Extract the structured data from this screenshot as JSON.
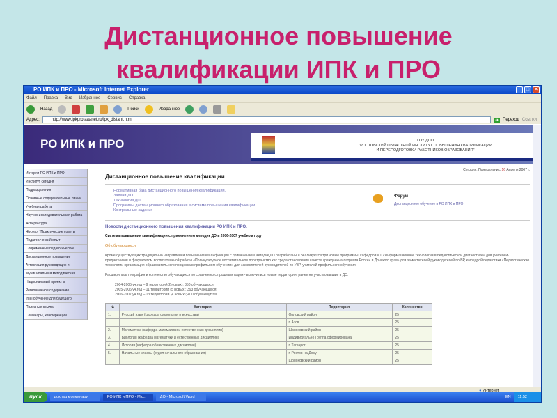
{
  "slide": {
    "title_line1": "Дистанционное повышение",
    "title_line2": "квалификации ИПК и ПРО"
  },
  "browser": {
    "title": "РО ИПК и ПРО - Microsoft Internet Explorer",
    "menu": [
      "Файл",
      "Правка",
      "Вид",
      "Избранное",
      "Сервис",
      "Справка"
    ],
    "toolbar": {
      "back": "Назад",
      "search": "Поиск",
      "favorites": "Избранное"
    },
    "address_label": "Адрес:",
    "address": "http://www.ipkpro.aaanet.ru/ipk_distant.html",
    "go": "Переход",
    "links": "Ссылки",
    "status": "Интернет"
  },
  "site": {
    "logo": "РО ИПК и ПРО",
    "org_line1": "ГОУ ДПО",
    "org_line2": "\"РОСТОВСКИЙ ОБЛАСТНОЙ ИНСТИТУТ ПОВЫШЕНИЯ КВАЛИФИКАЦИИ",
    "org_line3": "И ПЕРЕПОДГОТОВКИ РАБОТНИКОВ ОБРАЗОВАНИЯ\"",
    "date_prefix": "Сегодня: Понедельник,",
    "date_day": "16",
    "date_suffix": "Апреля 2007 г."
  },
  "sidebar": [
    "История РО ИПК и ПРО",
    "Институт сегодня",
    "Подразделения",
    "Основные содержательные линии ИПК",
    "Учебная работа",
    "Научно-исследовательская работа",
    "Аспирантура",
    "Журнал \"Практические советы учителю\"",
    "Педагогический опыт",
    "Современные педагогические технологии",
    "Дистанционное повышение квалификации",
    "Аттестация руководящих и педагогических кадров",
    "Муниципальная методическая служба",
    "Национальный проект в образовании",
    "Региональное содержание образования",
    "Intel обучение для будущего",
    "Полезные ссылки",
    "Семинары, конференции"
  ],
  "main": {
    "heading": "Дистанционное повышение квалификации",
    "links": [
      "Нормативная база дистанционного повышения квалификации.",
      "Задачи ДО",
      "Технология ДО",
      "Программы дистанционного образования в системе повышения квалификации",
      "Контрольные задания"
    ],
    "forum_title": "Форум",
    "forum_link": "Дистанционное обучение в РО ИПК и ПРО",
    "news_title": "Новости дистанционного повышения квалификации РО ИПК и ПРО.",
    "subtitle": "Система повышения квалификации с применением методик ДО в 2006-2007 учебном году",
    "section": "Об обучающихся",
    "para1": "Кроме существующих традиционно направлений повышения квалификации с применением методик ДО разработаны и реализуются три новые программы: кафедрой ИТ «Информационные технологии в педагогической диагностике» для учителей-предметников и факультетом воспитательной работы «Поликультурное воспитательное пространство как среда становления качеств гражданина-патриота России и Донского края» для заместителей руководителей по ВР, кафедрой педагогики «Педагогические технологии организации образовательного процесса в профильном обучении» для заместителей руководителей по УВР, учителей профильного обучения.",
    "para2": "Расширилась география и количество обучающихся по сравнению с прошлым годом - включились новые территории, ранее не участвовавшие в ДО.",
    "bullets": [
      "2004-2005 уч.год – 9 территорий(2 новых); 350 обучающихся;",
      "2005-2006 уч.год – 11 территорий (5 новых); 393 обучающихся;",
      "2006-2007 уч.год – 13 территорий (4 новых); 400 обучающихся."
    ],
    "table": {
      "headers": [
        "№",
        "Категория",
        "Территория",
        "Количество"
      ],
      "rows": [
        [
          "1.",
          "Русский язык (кафедра филологии и искусства)",
          "Орловский район",
          "25"
        ],
        [
          "",
          "",
          "г. Азов",
          "25"
        ],
        [
          "2.",
          "Математика (кафедра математики и естественных дисциплин)",
          "Шолоховский район",
          "25"
        ],
        [
          "3.",
          "Биология (кафедра математики и естественных дисциплин)",
          "Индивидуально Группа оформирована",
          "25"
        ],
        [
          "4.",
          "История (кафедра общественных дисциплин)",
          "г. Таганрог",
          "25"
        ],
        [
          "5.",
          "Начальные классы (отдел начального образования)",
          "г. Ростов-на-Дону",
          "25"
        ],
        [
          "",
          "",
          "Шолоховский район",
          "25"
        ]
      ]
    }
  },
  "taskbar": {
    "start": "пуск",
    "items": [
      "доклад к семинару",
      "РО ИПК и ПРО - Mic...",
      "ДО - Microsoft Word"
    ],
    "lang": "EN",
    "clock": "11:52"
  }
}
